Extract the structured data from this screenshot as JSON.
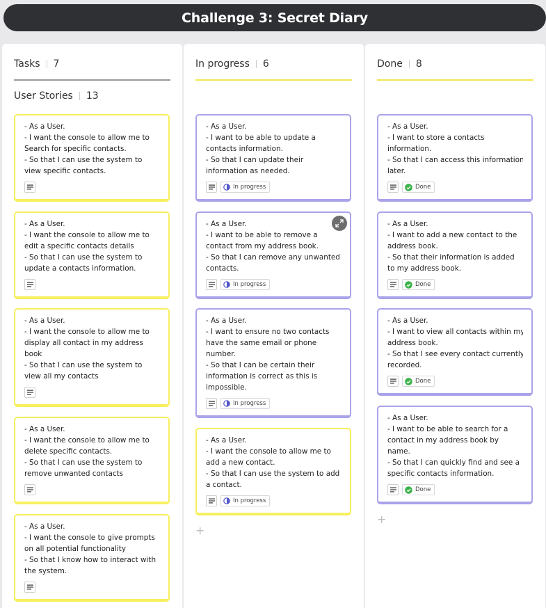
{
  "board": {
    "title": "Challenge 3: Secret Diary"
  },
  "colors": {
    "yellow": "#f7ef5e",
    "purple": "#a9a3ea",
    "done_green": "#3cb34a",
    "progress_blue": "#5457c9"
  },
  "columns": [
    {
      "title": "Tasks",
      "count": "7",
      "swimlane": {
        "title": "User Stories",
        "count": "13"
      },
      "cards": [
        {
          "lines": [
            "- As a User.",
            "- I want the console to  allow me to",
            "Search for specific contacts.",
            "- So that I  can use the system to",
            "view specific contacts."
          ],
          "color": "yellow"
        },
        {
          "lines": [
            "- As a User.",
            "- I want the console to  allow me to",
            "edit a specific contacts details",
            "- So that I  can use the system to",
            "update a contacts information."
          ],
          "color": "yellow"
        },
        {
          "lines": [
            "- As a User.",
            "- I want the console to  allow me to",
            "display all contact in my address",
            "book",
            "- So that I  can use the system to",
            "view all my contacts"
          ],
          "color": "yellow"
        },
        {
          "lines": [
            "- As a User.",
            "- I want the console to  allow me to",
            "delete specific contacts.",
            "- So that I  can use the system to",
            "remove unwanted contacts"
          ],
          "color": "yellow"
        },
        {
          "lines": [
            "- As a User.",
            "- I want the console to give prompts",
            "on all potential functionality",
            "- So that I know how to  interact with",
            "the system."
          ],
          "color": "yellow"
        }
      ]
    },
    {
      "title": "In progress",
      "count": "6",
      "cards": [
        {
          "lines": [
            "- As a User.",
            "- I want to be able to update a",
            "contacts information.",
            "- So that I can update their",
            "information as needed."
          ],
          "color": "purple",
          "status": "In progress"
        },
        {
          "lines": [
            "- As a User.",
            "- I want to be able to remove a",
            "contact from my address book.",
            "- So that I can remove any unwanted",
            "contacts."
          ],
          "color": "purple",
          "status": "In progress"
        },
        {
          "lines": [
            "- As a User.",
            "- I want to ensure no two contacts",
            "have the same email or phone",
            "number.",
            "- So that I can be certain their",
            "information is correct as this is",
            "impossible."
          ],
          "color": "purple",
          "status": "In progress"
        },
        {
          "lines": [
            "- As a User.",
            "- I want the console to  allow me to",
            "add a new contact.",
            "- So that I  can use the system to add",
            "a contact."
          ],
          "color": "yellow",
          "status": "In progress"
        }
      ],
      "add_label": "+"
    },
    {
      "title": "Done",
      "count": "8",
      "cards": [
        {
          "lines": [
            "- As a User.",
            "- I want to store a contacts",
            "information.",
            "- So that I can access this information",
            "later."
          ],
          "color": "purple",
          "status": "Done"
        },
        {
          "lines": [
            "- As a User.",
            "- I want to add a new contact to the",
            "address book.",
            "- So that their information is added",
            "to my address book."
          ],
          "color": "purple",
          "status": "Done"
        },
        {
          "lines": [
            "- As a User.",
            "- I want to view all contacts within my",
            "address book.",
            "- So that I see every contact currently",
            "recorded."
          ],
          "color": "purple",
          "status": "Done"
        },
        {
          "lines": [
            "- As a User.",
            "- I want to be able to search for a",
            "contact in my address book by",
            "name.",
            "- So that I can quickly find and see a",
            "specific contacts information."
          ],
          "color": "purple",
          "status": "Done"
        }
      ],
      "add_label": "+"
    }
  ]
}
